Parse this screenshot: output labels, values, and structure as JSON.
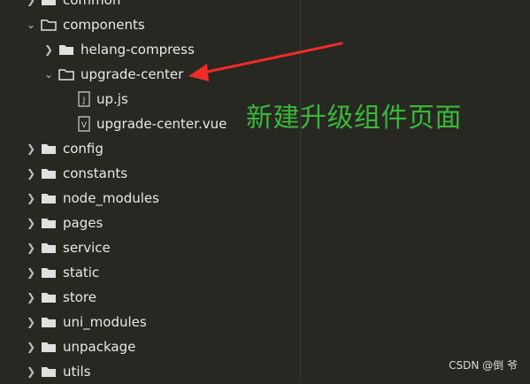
{
  "explorer": {
    "items": [
      {
        "label": "common",
        "type": "folder",
        "state": "collapsed",
        "indent": 0
      },
      {
        "label": "components",
        "type": "folder",
        "state": "expanded",
        "indent": 0
      },
      {
        "label": "helang-compress",
        "type": "folder",
        "state": "collapsed",
        "indent": 1
      },
      {
        "label": "upgrade-center",
        "type": "folder",
        "state": "expanded",
        "indent": 1
      },
      {
        "label": "up.js",
        "type": "file",
        "icon": "js-file-icon",
        "indent": 2
      },
      {
        "label": "upgrade-center.vue",
        "type": "file",
        "icon": "vue-file-icon",
        "indent": 2
      },
      {
        "label": "config",
        "type": "folder",
        "state": "collapsed",
        "indent": 0
      },
      {
        "label": "constants",
        "type": "folder",
        "state": "collapsed",
        "indent": 0
      },
      {
        "label": "node_modules",
        "type": "folder",
        "state": "collapsed",
        "indent": 0
      },
      {
        "label": "pages",
        "type": "folder",
        "state": "collapsed",
        "indent": 0
      },
      {
        "label": "service",
        "type": "folder",
        "state": "collapsed",
        "indent": 0
      },
      {
        "label": "static",
        "type": "folder",
        "state": "collapsed",
        "indent": 0
      },
      {
        "label": "store",
        "type": "folder",
        "state": "collapsed",
        "indent": 0
      },
      {
        "label": "uni_modules",
        "type": "folder",
        "state": "collapsed",
        "indent": 0
      },
      {
        "label": "unpackage",
        "type": "folder",
        "state": "collapsed",
        "indent": 0
      },
      {
        "label": "utils",
        "type": "folder",
        "state": "collapsed",
        "indent": 0
      }
    ]
  },
  "annotation": {
    "text": "新建升级组件页面",
    "color": "#39b73a"
  },
  "arrow_color": "#ef2b2b",
  "watermark": "CSDN @倒 爷",
  "colors": {
    "background": "#272822",
    "text": "#e8e8e8",
    "folder": "#e0e0e0"
  }
}
